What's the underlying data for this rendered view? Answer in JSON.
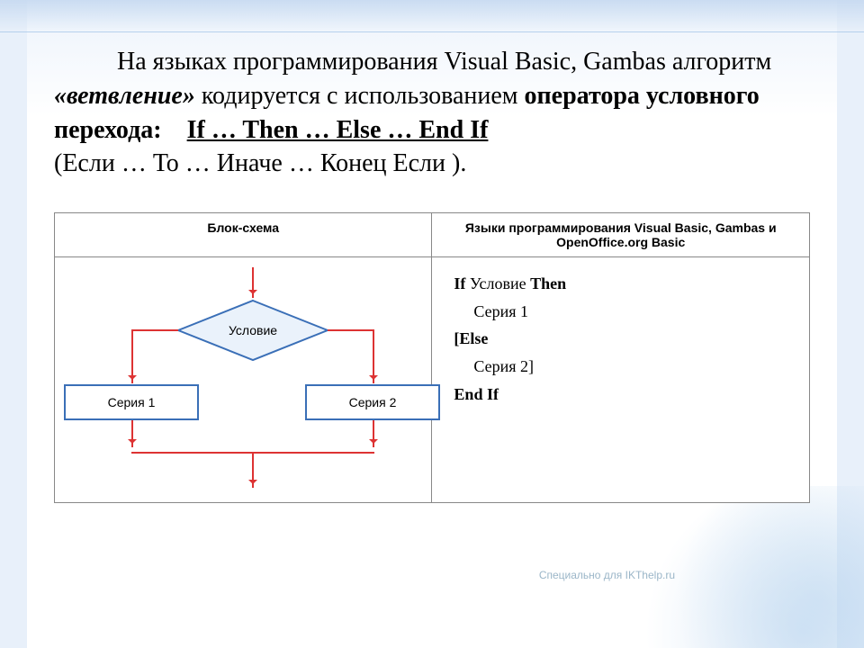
{
  "paragraph": {
    "t1": "На языках программирования Visual Basic, Gambas алгоритм ",
    "term": "«ветвление»",
    "t2": " кодируется с использованием ",
    "bold1": "оператора условного перехода:",
    "operator": "If … Then … Else … End If",
    "translation": "(Если … То … Иначе … Конец Если )."
  },
  "table": {
    "header_left": "Блок-схема",
    "header_right": "Языки программирования Visual Basic, Gambas и OpenOffice.org Basic"
  },
  "flowchart": {
    "condition": "Условие",
    "series1": "Серия 1",
    "series2": "Серия 2"
  },
  "code": {
    "l1a": "If",
    "l1b": " Условие ",
    "l1c": "Then",
    "l2": "Серия 1",
    "l3": "[Else",
    "l4": "Серия 2]",
    "l5a": "End",
    "l5b": " If"
  },
  "watermark": "Специально для IKThelp.ru"
}
